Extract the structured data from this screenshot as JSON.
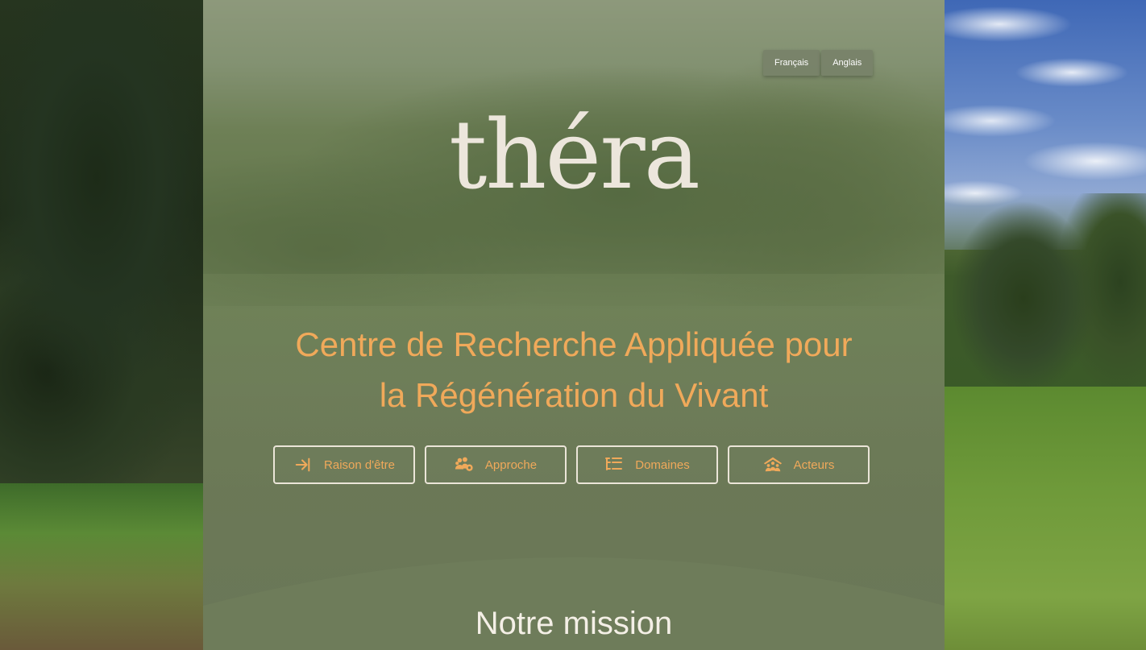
{
  "language_switch": {
    "french_label": "Français",
    "english_label": "Anglais"
  },
  "logo": {
    "text": "théra"
  },
  "hero": {
    "headline_line1": "Centre de Recherche Appliquée pour",
    "headline_line2": "la Régénération du Vivant"
  },
  "nav": {
    "items": [
      {
        "label": "Raison d'être",
        "icon": "arrow-right-icon"
      },
      {
        "label": "Approche",
        "icon": "team-icon"
      },
      {
        "label": "Domaines",
        "icon": "tree-list-icon"
      },
      {
        "label": "Acteurs",
        "icon": "people-roof-icon"
      }
    ]
  },
  "mission": {
    "title": "Notre mission"
  },
  "colors": {
    "accent": "#f0a95a",
    "panel": "#6e7c5a",
    "logo": "#ece6dc"
  }
}
